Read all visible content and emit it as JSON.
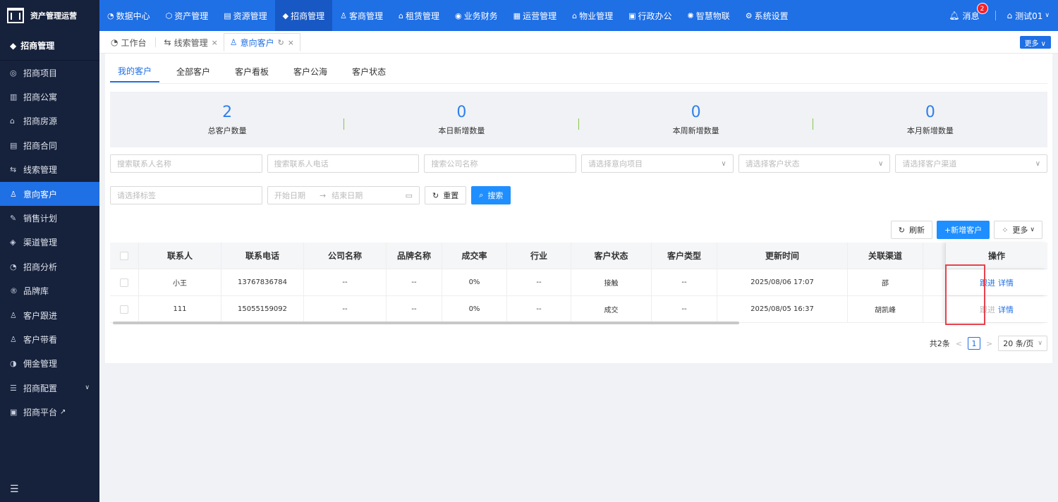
{
  "topbar": {
    "brand": "资产管理运营",
    "nav": [
      {
        "label": "数据中心",
        "icon": "◔"
      },
      {
        "label": "资产管理",
        "icon": "⬡"
      },
      {
        "label": "资源管理",
        "icon": "▤"
      },
      {
        "label": "招商管理",
        "icon": "◆"
      },
      {
        "label": "客商管理",
        "icon": "♙"
      },
      {
        "label": "租赁管理",
        "icon": "⌂"
      },
      {
        "label": "业务财务",
        "icon": "◉"
      },
      {
        "label": "运营管理",
        "icon": "▦"
      },
      {
        "label": "物业管理",
        "icon": "⌂"
      },
      {
        "label": "行政办公",
        "icon": "▣"
      },
      {
        "label": "智慧物联",
        "icon": "✺"
      },
      {
        "label": "系统设置",
        "icon": "⚙"
      }
    ],
    "message_label": "消息",
    "message_count": "2",
    "user_name": "测试01"
  },
  "sidebar": {
    "header": "招商管理",
    "items": [
      {
        "label": "招商项目",
        "icon": "◎"
      },
      {
        "label": "招商公寓",
        "icon": "▥"
      },
      {
        "label": "招商房源",
        "icon": "⌂"
      },
      {
        "label": "招商合同",
        "icon": "▤"
      },
      {
        "label": "线索管理",
        "icon": "⇆"
      },
      {
        "label": "意向客户",
        "icon": "♙"
      },
      {
        "label": "销售计划",
        "icon": "✎"
      },
      {
        "label": "渠道管理",
        "icon": "◈"
      },
      {
        "label": "招商分析",
        "icon": "◔"
      },
      {
        "label": "品牌库",
        "icon": "®"
      },
      {
        "label": "客户跟进",
        "icon": "♙"
      },
      {
        "label": "客户带看",
        "icon": "♙"
      },
      {
        "label": "佣金管理",
        "icon": "◑"
      },
      {
        "label": "招商配置",
        "icon": "☰"
      },
      {
        "label": "招商平台",
        "icon": "▣"
      }
    ]
  },
  "tabs": {
    "items": [
      {
        "label": "工作台",
        "icon": "◔"
      },
      {
        "label": "线索管理",
        "icon": "⇆",
        "close": "×"
      },
      {
        "label": "意向客户",
        "icon": "♙",
        "refresh": "↻",
        "close": "×"
      }
    ],
    "more_label": "更多 ∨"
  },
  "subtabs": [
    "我的客户",
    "全部客户",
    "客户看板",
    "客户公海",
    "客户状态"
  ],
  "stats": [
    {
      "value": "2",
      "label": "总客户数量"
    },
    {
      "value": "0",
      "label": "本日新增数量"
    },
    {
      "value": "0",
      "label": "本周新增数量"
    },
    {
      "value": "0",
      "label": "本月新增数量"
    }
  ],
  "filters": {
    "contact_name": "搜索联系人名称",
    "contact_phone": "搜索联系人电话",
    "company_name": "搜索公司名称",
    "project": "请选择意向项目",
    "status": "请选择客户状态",
    "channel": "请选择客户渠道",
    "tag": "请选择标签",
    "start_date": "开始日期",
    "end_date": "结束日期",
    "reset_label": "重置",
    "search_label": "搜索"
  },
  "toolbar": {
    "refresh_label": "刷新",
    "add_label": "+新增客户",
    "more_label": "更多"
  },
  "table": {
    "columns": [
      "联系人",
      "联系电话",
      "公司名称",
      "品牌名称",
      "成交率",
      "行业",
      "客户状态",
      "客户类型",
      "更新时间",
      "关联渠道",
      "",
      "操作"
    ],
    "rows": [
      [
        "小王",
        "13767836784",
        "--",
        "--",
        "0%",
        "--",
        "接触",
        "--",
        "2025/08/06 17:07",
        "邵",
        ""
      ],
      [
        "111",
        "15055159092",
        "--",
        "--",
        "0%",
        "--",
        "成交",
        "--",
        "2025/08/05 16:37",
        "胡凯峰",
        ""
      ]
    ],
    "action_follow": "跟进",
    "action_detail": "详情"
  },
  "pagination": {
    "total": "共2条",
    "prev": "<",
    "current": "1",
    "next": ">",
    "page_size": "20 条/页"
  }
}
